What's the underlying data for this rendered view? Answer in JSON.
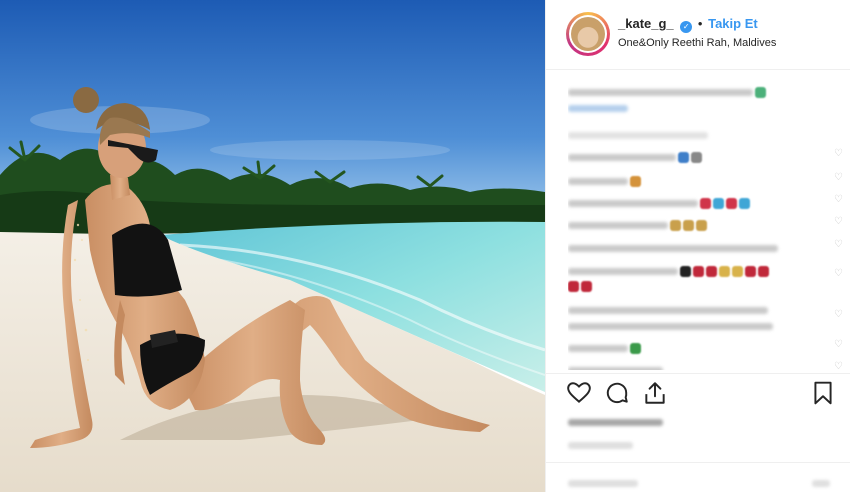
{
  "post": {
    "username": "_kate_g_",
    "verified_mark": "✓",
    "separator": "•",
    "follow_label": "Takip Et",
    "location": "One&Only Reethi Rah, Maldives"
  },
  "photo": {
    "icon": "beach-photo",
    "colors": {
      "sky_top": "#1f5fb8",
      "sky_bottom": "#8fc2ec",
      "sea": "#6fd3dc",
      "sand": "#efe7da",
      "palms": "#1d4a1c",
      "swimsuit": "#111111",
      "skin": "#d9a57c"
    }
  },
  "actions": {
    "like_icon": "heart-icon",
    "comment_icon": "comment-icon",
    "share_icon": "share-icon",
    "save_icon": "bookmark-icon"
  },
  "colors": {
    "accent": "#3897f0",
    "text": "#262626",
    "divider": "#efefef"
  }
}
